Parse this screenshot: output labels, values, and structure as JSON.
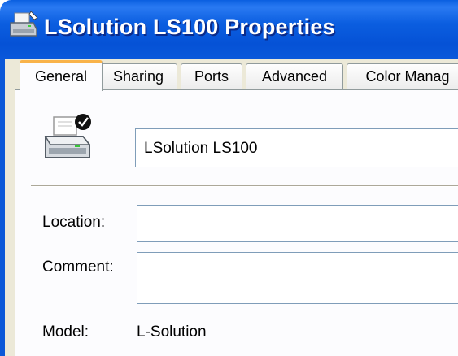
{
  "window": {
    "title": "LSolution LS100 Properties",
    "icon": "printer-icon"
  },
  "tabs": [
    {
      "label": "General",
      "active": true
    },
    {
      "label": "Sharing",
      "active": false
    },
    {
      "label": "Ports",
      "active": false
    },
    {
      "label": "Advanced",
      "active": false
    },
    {
      "label": "Color Manag",
      "active": false
    }
  ],
  "general": {
    "printer_name": "LSolution LS100",
    "location_label": "Location:",
    "location_value": "",
    "comment_label": "Comment:",
    "comment_value": "",
    "model_label": "Model:",
    "model_value": "L-Solution",
    "printer_icon": "printer-default-icon"
  },
  "colors": {
    "titlebar": "#0a5fe0",
    "tab_active_accent": "#f9b34a",
    "dialog_background": "#ece9d8"
  }
}
